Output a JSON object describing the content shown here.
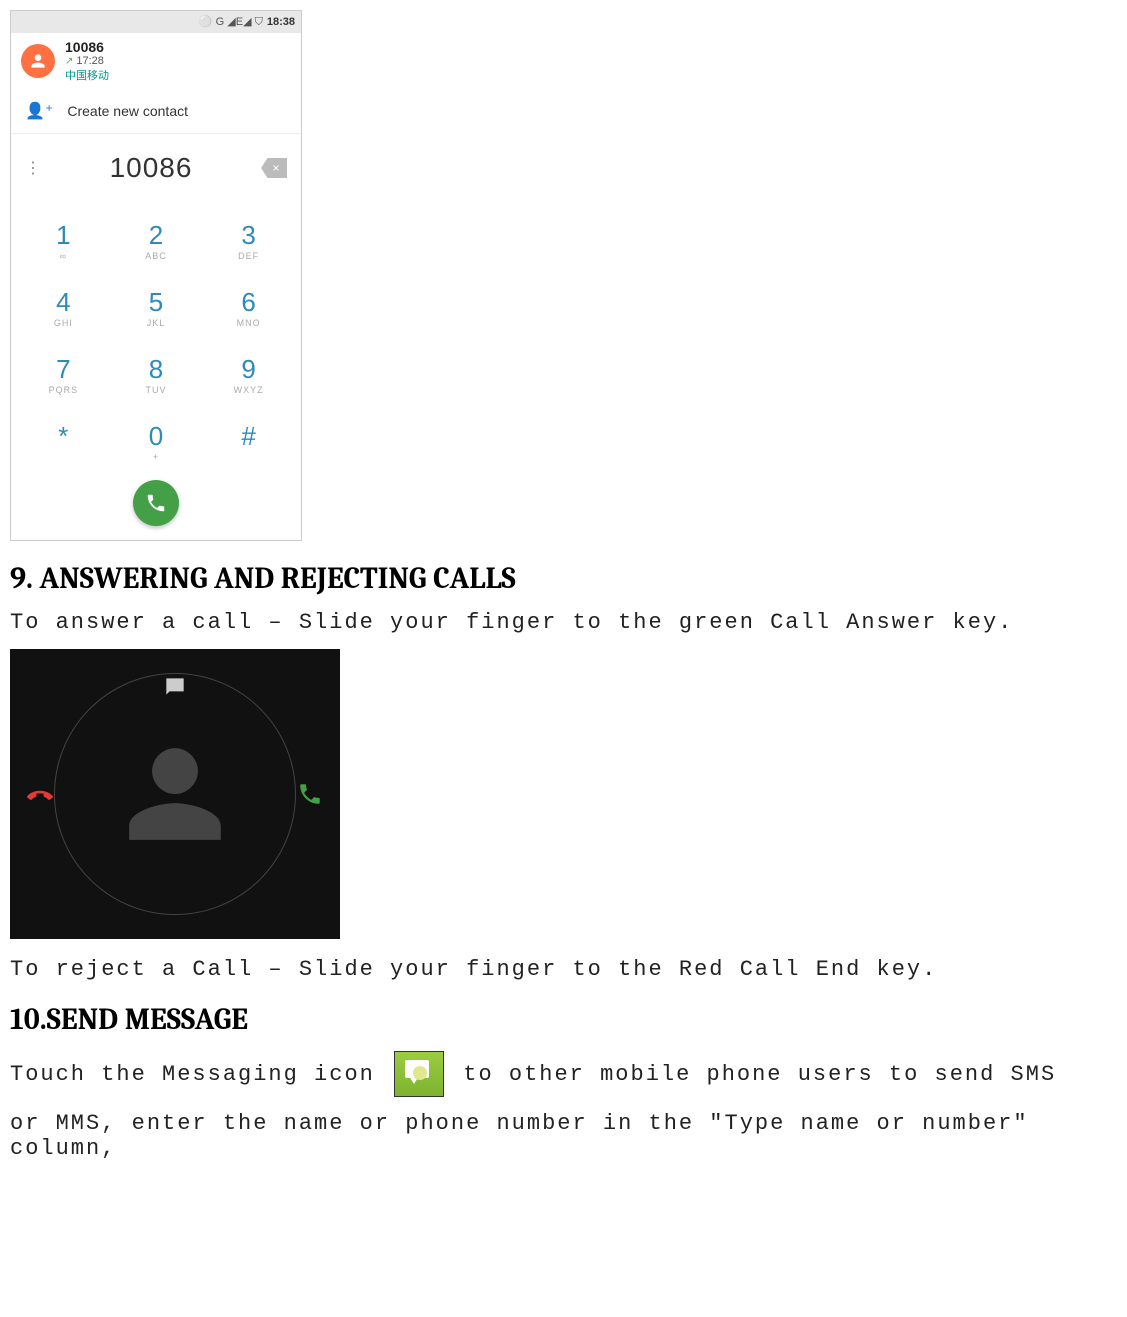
{
  "dialer": {
    "status": {
      "indicators": "⚪ G ◢E◢ ⛉",
      "time": "18:38"
    },
    "contact": {
      "name": "10086",
      "time": "17:28",
      "carrier": "中国移动"
    },
    "create_label": "Create new contact",
    "number": "10086",
    "keys": [
      {
        "num": "1",
        "sub": "∞"
      },
      {
        "num": "2",
        "sub": "ABC"
      },
      {
        "num": "3",
        "sub": "DEF"
      },
      {
        "num": "4",
        "sub": "GHI"
      },
      {
        "num": "5",
        "sub": "JKL"
      },
      {
        "num": "6",
        "sub": "MNO"
      },
      {
        "num": "7",
        "sub": "PQRS"
      },
      {
        "num": "8",
        "sub": "TUV"
      },
      {
        "num": "9",
        "sub": "WXYZ"
      },
      {
        "num": "*",
        "sub": ""
      },
      {
        "num": "0",
        "sub": "+"
      },
      {
        "num": "#",
        "sub": ""
      }
    ]
  },
  "headings": {
    "s9": "9. ANSWERING AND REJECTING CALLS",
    "s10": "10.SEND MESSAGE"
  },
  "text": {
    "answer": "To answer a call – Slide your finger to the green Call Answer key.",
    "reject": "To reject a Call – Slide your finger to the Red Call End key.",
    "send_pre": "Touch the Messaging icon ",
    "send_post": " to other mobile phone users to send SMS",
    "send_line2": "or MMS, enter the name or phone number in the \"Type name or number\" column,"
  }
}
